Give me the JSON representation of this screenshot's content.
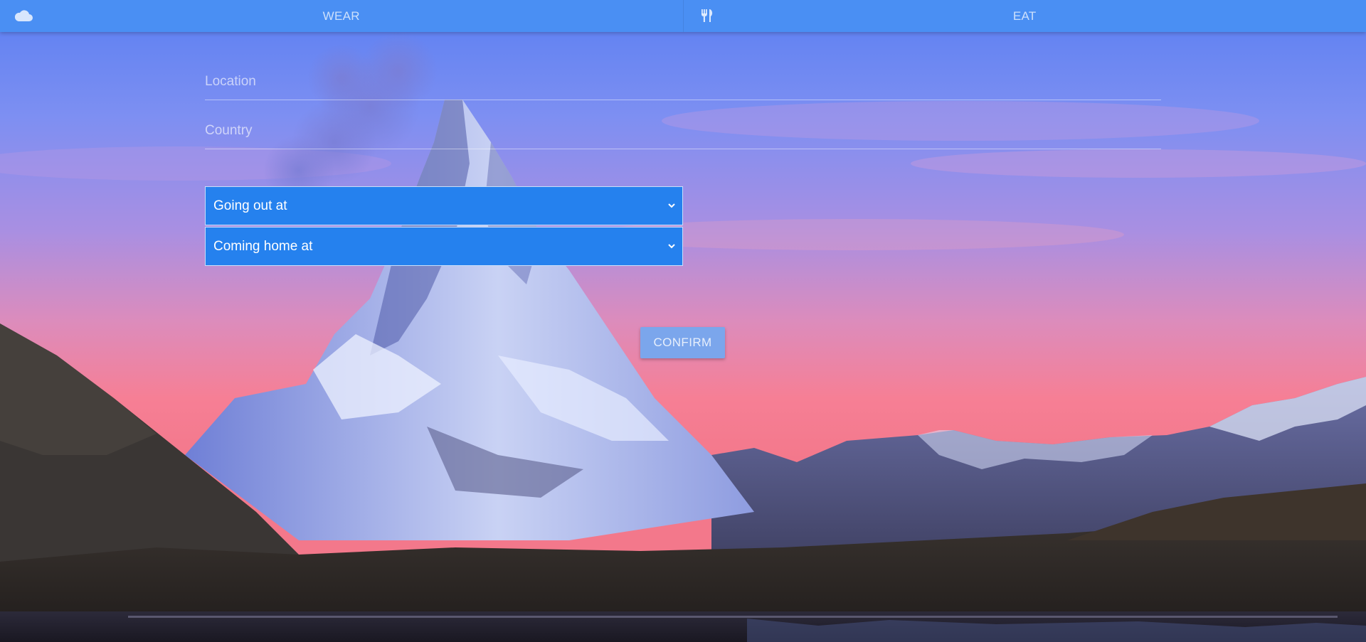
{
  "nav": {
    "items": [
      {
        "label": "WEAR",
        "icon": "cloud-icon"
      },
      {
        "label": "EAT",
        "icon": "fork-knife-icon"
      }
    ],
    "background": "#4a8ff3"
  },
  "form": {
    "location": {
      "value": "",
      "placeholder": "Location"
    },
    "country": {
      "value": "",
      "placeholder": "Country"
    },
    "going_out": {
      "selected": "Going out at"
    },
    "coming_home": {
      "selected": "Coming home at"
    },
    "select_background": "#2581ee"
  },
  "confirm": {
    "label": "CONFIRM",
    "background": "#7ba6ec"
  },
  "background": {
    "description_icon": "mountain-landscape-image",
    "sky_top": "#6f8ef0",
    "sky_bottom": "#f2748c"
  }
}
